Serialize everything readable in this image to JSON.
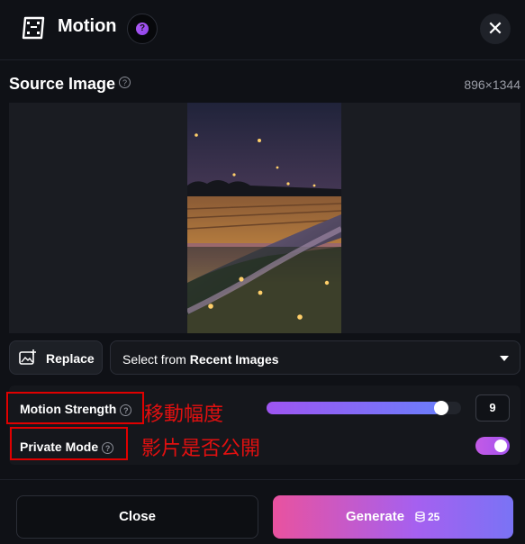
{
  "header": {
    "title": "Motion",
    "help_glyph": "?",
    "close_glyph": "✕",
    "logo_icon": "film-icon"
  },
  "source": {
    "title": "Source Image",
    "dimensions": "896×1344",
    "help_glyph": "?"
  },
  "toolbar": {
    "replace_label": "Replace",
    "replace_icon": "image-add-icon",
    "select_prefix": "Select from ",
    "select_bold": "Recent Images"
  },
  "settings": {
    "motion_strength_label": "Motion Strength",
    "motion_strength_value": "9",
    "motion_strength_fraction": 0.9,
    "private_mode_label": "Private Mode",
    "private_mode_on": true,
    "help_glyph": "?"
  },
  "annotations": {
    "motion_strength_note": "移動幅度",
    "private_mode_note": "影片是否公開"
  },
  "footer": {
    "close_label": "Close",
    "generate_label": "Generate",
    "generate_cost": "25",
    "cost_icon": "coins-icon"
  },
  "colors": {
    "accent_purple": "#a453ee",
    "generate_gradient_start": "#e9529f",
    "generate_gradient_end": "#7a73f5",
    "annotation_red": "#e00000",
    "background": "#0f1116"
  }
}
